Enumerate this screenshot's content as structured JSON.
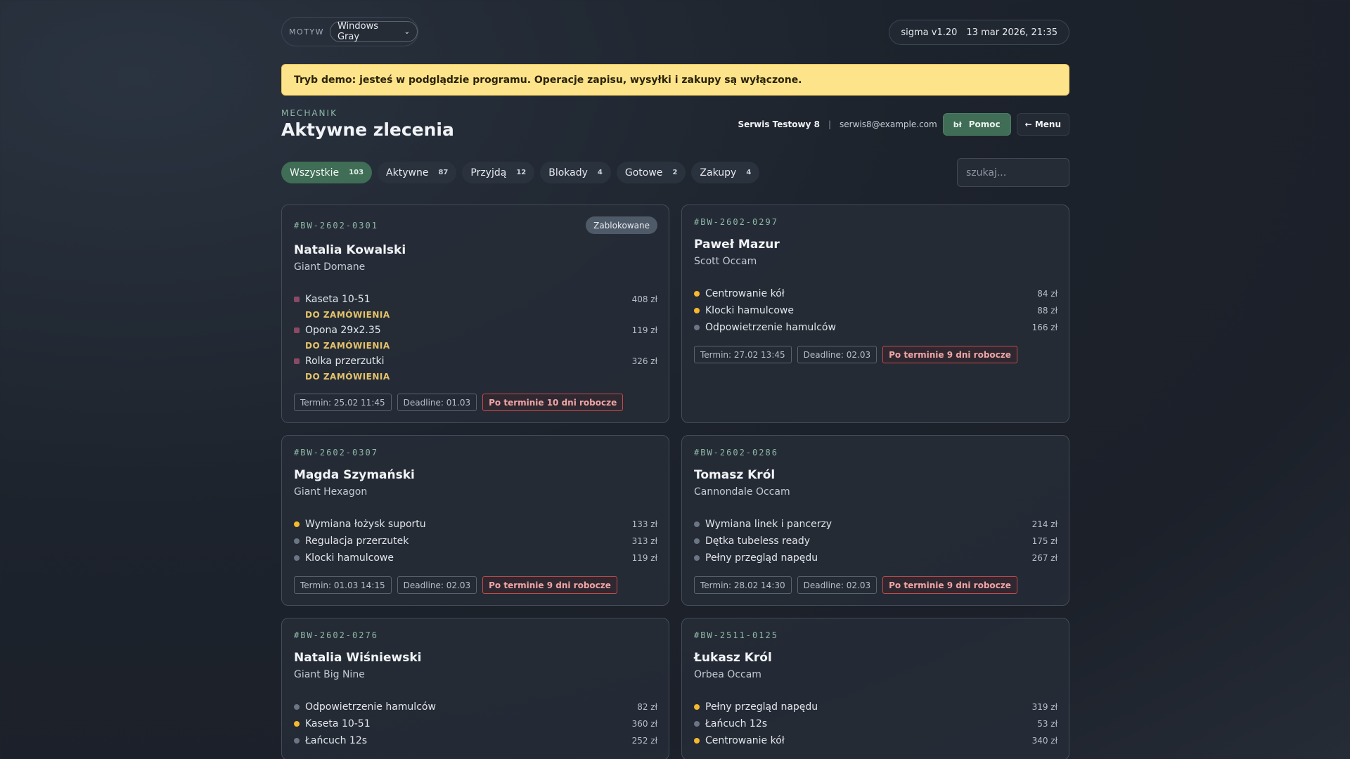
{
  "theme": {
    "label": "MOTYW",
    "value": "Windows Gray"
  },
  "version": {
    "app": "sigma v1.20",
    "datetime": "13 mar 2026, 21:35"
  },
  "banner": "Tryb demo: jesteś w podglądzie programu. Operacje zapisu, wysyłki i zakupy są wyłączone.",
  "header": {
    "eyebrow": "MECHANIK",
    "title": "Aktywne zlecenia",
    "shop": "Serwis Testowy 8",
    "separator": "|",
    "email": "serwis8@example.com",
    "help_icon": "bł",
    "help_label": "Pomoc",
    "menu_label": "← Menu"
  },
  "filters": [
    {
      "label": "Wszystkie",
      "count": "103"
    },
    {
      "label": "Aktywne",
      "count": "87"
    },
    {
      "label": "Przyjdą",
      "count": "12"
    },
    {
      "label": "Blokady",
      "count": "4"
    },
    {
      "label": "Gotowe",
      "count": "2"
    },
    {
      "label": "Zakupy",
      "count": "4"
    }
  ],
  "search": {
    "placeholder": "szukaj..."
  },
  "colors": {
    "accent": "#3f6d55",
    "warning": "#f5b82e",
    "blocked": "#8a4a64",
    "neutral": "#6b7585",
    "late": "#c34a4a"
  },
  "cards": [
    {
      "id": "#BW-2602-0301",
      "badge": "Zablokowane",
      "name": "Natalia Kowalski",
      "bike": "Giant Domane",
      "items": [
        {
          "name": "Kaseta 10-51",
          "price": "408 zł",
          "status": "blocked",
          "tag": "DO ZAMÓWIENIA"
        },
        {
          "name": "Opona 29x2.35",
          "price": "119 zł",
          "status": "blocked",
          "tag": "DO ZAMÓWIENIA"
        },
        {
          "name": "Rolka przerzutki",
          "price": "326 zł",
          "status": "blocked",
          "tag": "DO ZAMÓWIENIA"
        }
      ],
      "termin": "Termin: 25.02 11:45",
      "deadline": "Deadline: 01.03",
      "late": "Po terminie 10 dni robocze"
    },
    {
      "id": "#BW-2602-0297",
      "name": "Paweł Mazur",
      "bike": "Scott Occam",
      "items": [
        {
          "name": "Centrowanie kół",
          "price": "84 zł",
          "status": "warning"
        },
        {
          "name": "Klocki hamulcowe",
          "price": "88 zł",
          "status": "warning"
        },
        {
          "name": "Odpowietrzenie hamulców",
          "price": "166 zł",
          "status": "neutral"
        }
      ],
      "termin": "Termin: 27.02 13:45",
      "deadline": "Deadline: 02.03",
      "late": "Po terminie 9 dni robocze"
    },
    {
      "id": "#BW-2602-0307",
      "name": "Magda Szymański",
      "bike": "Giant Hexagon",
      "items": [
        {
          "name": "Wymiana łożysk suportu",
          "price": "133 zł",
          "status": "warning"
        },
        {
          "name": "Regulacja przerzutek",
          "price": "313 zł",
          "status": "neutral"
        },
        {
          "name": "Klocki hamulcowe",
          "price": "119 zł",
          "status": "neutral"
        }
      ],
      "termin": "Termin: 01.03 14:15",
      "deadline": "Deadline: 02.03",
      "late": "Po terminie 9 dni robocze"
    },
    {
      "id": "#BW-2602-0286",
      "name": "Tomasz Król",
      "bike": "Cannondale Occam",
      "items": [
        {
          "name": "Wymiana linek i pancerzy",
          "price": "214 zł",
          "status": "neutral"
        },
        {
          "name": "Dętka tubeless ready",
          "price": "175 zł",
          "status": "neutral"
        },
        {
          "name": "Pełny przegląd napędu",
          "price": "267 zł",
          "status": "neutral"
        }
      ],
      "termin": "Termin: 28.02 14:30",
      "deadline": "Deadline: 02.03",
      "late": "Po terminie 9 dni robocze"
    },
    {
      "id": "#BW-2602-0276",
      "name": "Natalia Wiśniewski",
      "bike": "Giant Big Nine",
      "items": [
        {
          "name": "Odpowietrzenie hamulców",
          "price": "82 zł",
          "status": "neutral"
        },
        {
          "name": "Kaseta 10-51",
          "price": "360 zł",
          "status": "warning"
        },
        {
          "name": "Łańcuch 12s",
          "price": "252 zł",
          "status": "neutral"
        }
      ]
    },
    {
      "id": "#BW-2511-0125",
      "name": "Łukasz Król",
      "bike": "Orbea Occam",
      "items": [
        {
          "name": "Pełny przegląd napędu",
          "price": "319 zł",
          "status": "warning"
        },
        {
          "name": "Łańcuch 12s",
          "price": "53 zł",
          "status": "neutral"
        },
        {
          "name": "Centrowanie kół",
          "price": "340 zł",
          "status": "warning"
        }
      ]
    }
  ]
}
